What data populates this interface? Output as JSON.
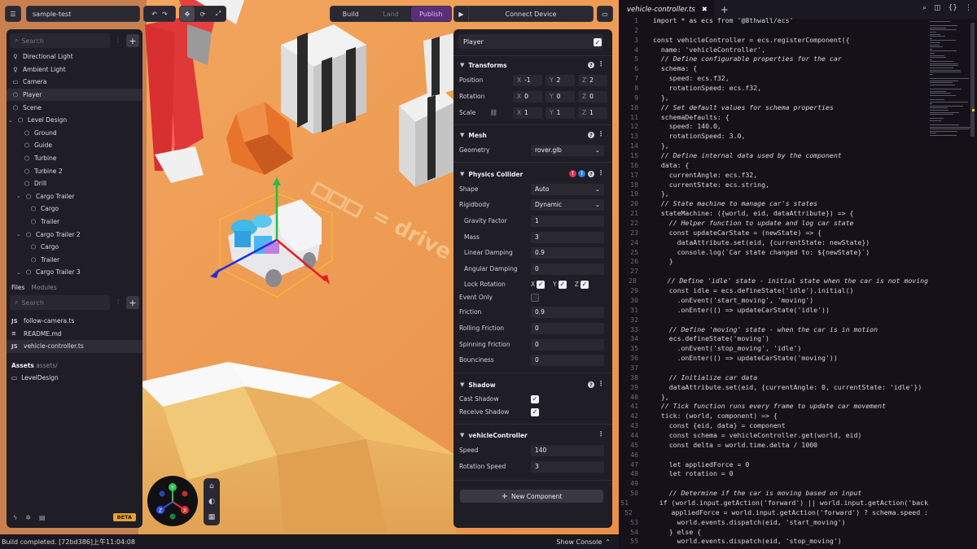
{
  "toolbar": {
    "project_name": "sample-test",
    "build_label": "Build",
    "land_label": "Land",
    "publish_label": "Publish",
    "connect_label": "Connect Device"
  },
  "hierarchy": {
    "search_placeholder": "Search",
    "items": [
      {
        "label": "Directional Light",
        "icon": "lightbulb-icon"
      },
      {
        "label": "Ambient Light",
        "icon": "lightbulb-icon"
      },
      {
        "label": "Camera",
        "icon": "camera-icon"
      },
      {
        "label": "Player",
        "icon": "cube-icon"
      },
      {
        "label": "Scene",
        "icon": "cube-icon"
      },
      {
        "label": "Level Design",
        "icon": "cube-icon"
      },
      {
        "label": "Ground",
        "icon": "cube-icon"
      },
      {
        "label": "Guide",
        "icon": "cube-icon"
      },
      {
        "label": "Turbine",
        "icon": "cube-icon"
      },
      {
        "label": "Turbine 2",
        "icon": "cube-icon"
      },
      {
        "label": "Drill",
        "icon": "cube-icon"
      },
      {
        "label": "Cargo Trailer",
        "icon": "cube-icon"
      },
      {
        "label": "Cargo",
        "icon": "cube-icon"
      },
      {
        "label": "Trailer",
        "icon": "cube-icon"
      },
      {
        "label": "Cargo Trailer 2",
        "icon": "cube-icon"
      },
      {
        "label": "Cargo",
        "icon": "cube-icon"
      },
      {
        "label": "Trailer",
        "icon": "cube-icon"
      },
      {
        "label": "Cargo Trailer 3",
        "icon": "cube-icon"
      }
    ]
  },
  "files": {
    "tab_files": "Files",
    "tab_modules": "Modules",
    "search_placeholder": "Search",
    "items": [
      {
        "type": "JS",
        "name": "follow-camera.ts"
      },
      {
        "type": "≡",
        "name": "README.md"
      },
      {
        "type": "JS",
        "name": "vehicle-controller.ts"
      }
    ],
    "assets_label": "Assets",
    "assets_path": "assets/",
    "asset_folder": "LevelDesign",
    "beta_label": "BETA"
  },
  "inspector": {
    "entity_name": "Player",
    "transforms": {
      "title": "Transforms",
      "position_label": "Position",
      "position": [
        "-1",
        "2",
        "2"
      ],
      "rotation_label": "Rotation",
      "rotation": [
        "0",
        "0",
        "0"
      ],
      "scale_label": "Scale",
      "scale": [
        "1",
        "1",
        "1"
      ],
      "x": "X",
      "y": "Y",
      "z": "Z"
    },
    "mesh": {
      "title": "Mesh",
      "geometry_label": "Geometry",
      "geometry": "rover.glb"
    },
    "physics": {
      "title": "Physics Collider",
      "shape_label": "Shape",
      "shape": "Auto",
      "rigidbody_label": "Rigidbody",
      "rigidbody": "Dynamic",
      "gravity_label": "Gravity Factor",
      "gravity": "1",
      "mass_label": "Mass",
      "mass": "3",
      "lin_damp_label": "Linear Damping",
      "lin_damp": "0.9",
      "ang_damp_label": "Angular Damping",
      "ang_damp": "0",
      "lock_rot_label": "Lock Rotation",
      "event_only_label": "Event Only",
      "friction_label": "Friction",
      "friction": "0.9",
      "rolling_label": "Rolling Friction",
      "rolling": "0",
      "spinning_label": "Spinning Friction",
      "spinning": "0",
      "bounciness_label": "Bounciness",
      "bounciness": "0"
    },
    "shadow": {
      "title": "Shadow",
      "cast_label": "Cast Shadow",
      "receive_label": "Receive Shadow"
    },
    "vehicle": {
      "title": "vehicleController",
      "speed_label": "Speed",
      "speed": "140",
      "rot_speed_label": "Rotation Speed",
      "rot_speed": "3"
    },
    "new_component": "New Component"
  },
  "editor": {
    "tab_name": "vehicle-controller.ts",
    "lines": [
      "import * as ecs from '@8thwall/ecs'",
      "",
      "const vehicleController = ecs.registerComponent({",
      "  name: 'vehicleController',",
      "  // Define configurable properties for the car",
      "  schema: {",
      "    speed: ecs.f32,",
      "    rotationSpeed: ecs.f32,",
      "  },",
      "  // Set default values for schema properties",
      "  schemaDefaults: {",
      "    speed: 140.0,",
      "    rotationSpeed: 3.0,",
      "  },",
      "  // Define internal data used by the component",
      "  data: {",
      "    currentAngle: ecs.f32,",
      "    currentState: ecs.string,",
      "  },",
      "  // State machine to manage car's states",
      "  stateMachine: ({world, eid, dataAttribute}) => {",
      "    // Helper function to update and log car state",
      "    const updateCarState = (newState) => {",
      "      dataAttribute.set(eid, {currentState: newState})",
      "      console.log(`Car state changed to: ${newState}`)",
      "    }",
      "",
      "    // Define 'idle' state - initial state when the car is not moving",
      "    const idle = ecs.defineState('idle').initial()",
      "      .onEvent('start_moving', 'moving')",
      "      .onEnter(() => updateCarState('idle'))",
      "",
      "    // Define 'moving' state - when the car is in motion",
      "    ecs.defineState('moving')",
      "      .onEvent('stop_moving', 'idle')",
      "      .onEnter(() => updateCarState('moving'))",
      "",
      "    // Initialize car data",
      "    dataAttribute.set(eid, {currentAngle: 0, currentState: 'idle'})",
      "  },",
      "  // Tick function runs every frame to update car movement",
      "  tick: (world, component) => {",
      "    const {eid, data} = component",
      "    const schema = vehicleController.get(world, eid)",
      "    const delta = world.time.delta / 1000",
      "",
      "    let appliedForce = 0",
      "    let rotation = 0",
      "",
      "    // Determine if the car is moving based on input",
      "    if (world.input.getAction('forward') || world.input.getAction('back",
      "      appliedForce = world.input.getAction('forward') ? schema.speed :",
      "      world.events.dispatch(eid, 'start_moving')",
      "    } else {",
      "      world.events.dispatch(eid, 'stop_moving')"
    ]
  },
  "status": {
    "message": "Build completed. [72bd386]上午11:04:08",
    "show_console": "Show Console"
  },
  "scene": {
    "floor_text": "= drive"
  }
}
